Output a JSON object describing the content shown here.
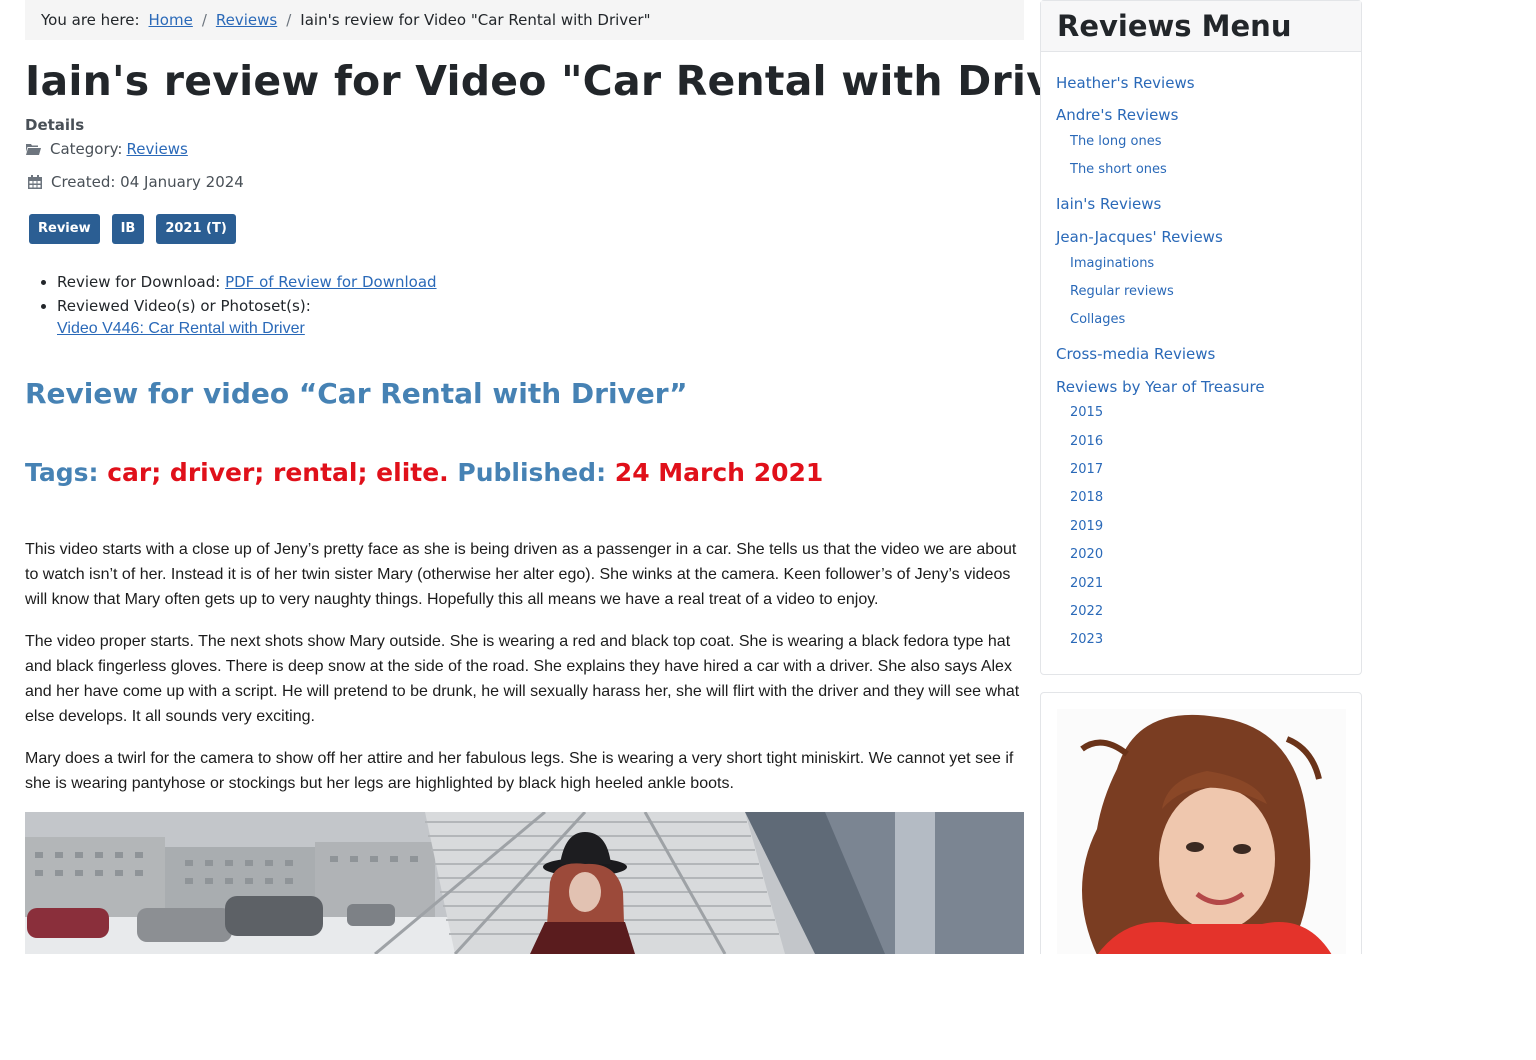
{
  "breadcrumb": {
    "prefix": "You are here:",
    "home": "Home",
    "reviews": "Reviews",
    "current": "Iain's review for Video \"Car Rental with Driver\"",
    "separator": "/"
  },
  "article": {
    "title": "Iain's review for Video \"Car Rental with Driver\"",
    "details_label": "Details",
    "category_label": "Category:",
    "category_value": "Reviews",
    "created": "Created: 04 January 2024",
    "tags": [
      "Review",
      "IB",
      "2021 (T)"
    ],
    "download_label": "Review for Download:",
    "download_link": "PDF of Review for Download",
    "reviewed_label": "Reviewed Video(s) or Photoset(s):",
    "video_link": "Video V446: Car Rental with Driver",
    "subtitle": "Review for video “Car Rental with Driver”",
    "tagline": {
      "tags_label": "Tags:",
      "tags_value": "car; driver; rental; elite.",
      "published_label": "Published:",
      "published_value": "24 March 2021"
    },
    "paragraphs": [
      "This video starts with a close up of Jeny’s pretty face as she is being driven as a passenger in a car. She tells us that the video we are about to watch isn’t of her. Instead it is of her twin sister Mary (otherwise her alter ego). She winks at the camera. Keen follower’s of Jeny’s videos will know that Mary often gets up to very naughty things. Hopefully this all means we have a real treat of a video to enjoy.",
      "The video proper starts. The next shots show Mary outside. She is wearing a red and black top coat. She is wearing a black fedora type hat and black fingerless gloves. There is deep snow at the side of the road. She explains they have hired a car with a driver. She also says Alex and her have come up with a script. He will pretend to be drunk, he will sexually harass her, she will flirt with the driver and they will see what else develops. It all sounds very exciting.",
      "Mary does a twirl for the camera to show off her attire and her fabulous legs. She is wearing a very short tight miniskirt. We cannot yet see if she is wearing pantyhose or stockings but her legs are highlighted by black high heeled ankle boots."
    ]
  },
  "sidebar": {
    "menu_title": "Reviews Menu",
    "items": [
      "Heather's Reviews",
      "Andre's Reviews",
      "The long ones",
      "The short ones",
      "Iain's Reviews",
      "Jean-Jacques' Reviews",
      "Imaginations",
      "Regular reviews",
      "Collages",
      "Cross-media Reviews",
      "Reviews by Year of Treasure",
      "2015",
      "2016",
      "2017",
      "2018",
      "2019",
      "2020",
      "2021",
      "2022",
      "2023"
    ]
  },
  "colors": {
    "link": "#2a69b8",
    "tag_bg": "#2b5e93",
    "subtitle": "#4682b4",
    "accent_red": "#e0101a"
  }
}
